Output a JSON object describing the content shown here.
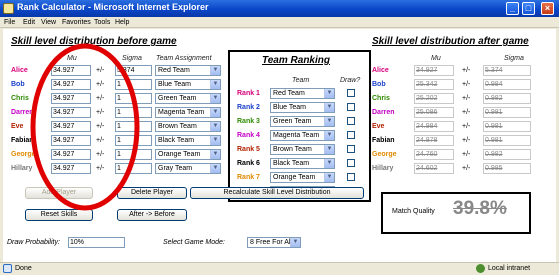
{
  "window": {
    "title": "Rank Calculator - Microsoft Internet Explorer",
    "min": "_",
    "max": "□",
    "close": "×"
  },
  "menu": [
    "File",
    "Edit",
    "View",
    "Favorites",
    "Tools",
    "Help"
  ],
  "before": {
    "heading": "Skill level distribution before game",
    "col_mu": "Mu",
    "col_sigma": "Sigma",
    "col_team": "Team Assignment",
    "pm": "+/-",
    "players": [
      {
        "name": "Alice",
        "color": "#d6007a",
        "mu": "34.927",
        "sigma": "5.374",
        "team": "Red Team"
      },
      {
        "name": "Bob",
        "color": "#1a3fc9",
        "mu": "34.927",
        "sigma": "1",
        "team": "Blue Team"
      },
      {
        "name": "Chris",
        "color": "#2e8b00",
        "mu": "34.927",
        "sigma": "1",
        "team": "Green Team"
      },
      {
        "name": "Darren",
        "color": "#c400c4",
        "mu": "34.927",
        "sigma": "1",
        "team": "Magenta Team"
      },
      {
        "name": "Eve",
        "color": "#b02000",
        "mu": "34.927",
        "sigma": "1",
        "team": "Brown Team"
      },
      {
        "name": "Fabian",
        "color": "#000000",
        "mu": "34.927",
        "sigma": "1",
        "team": "Black Team"
      },
      {
        "name": "George",
        "color": "#e08a00",
        "mu": "34.927",
        "sigma": "1",
        "team": "Orange Team"
      },
      {
        "name": "Hillary",
        "color": "#777777",
        "mu": "34.927",
        "sigma": "1",
        "team": "Gray Team"
      }
    ]
  },
  "ranking": {
    "heading": "Team Ranking",
    "col_team": "Team",
    "col_draw": "Draw?",
    "ranks": [
      {
        "label": "Rank 1",
        "color": "#d6007a",
        "team": "Red Team"
      },
      {
        "label": "Rank 2",
        "color": "#1a3fc9",
        "team": "Blue Team"
      },
      {
        "label": "Rank 3",
        "color": "#2e8b00",
        "team": "Green Team"
      },
      {
        "label": "Rank 4",
        "color": "#c400c4",
        "team": "Magenta Team"
      },
      {
        "label": "Rank 5",
        "color": "#b02000",
        "team": "Brown Team"
      },
      {
        "label": "Rank 6",
        "color": "#000000",
        "team": "Black Team"
      },
      {
        "label": "Rank 7",
        "color": "#e08a00",
        "team": "Orange Team"
      },
      {
        "label": "Rank 8",
        "color": "#777777",
        "team": "Gray Team"
      }
    ]
  },
  "after": {
    "heading": "Skill level distribution after game",
    "col_mu": "Mu",
    "col_sigma": "Sigma",
    "pm": "+/-",
    "players": [
      {
        "name": "Alice",
        "color": "#d6007a",
        "mu": "34.927",
        "sigma": "5.374"
      },
      {
        "name": "Bob",
        "color": "#1a3fc9",
        "mu": "25.342",
        "sigma": "0.984"
      },
      {
        "name": "Chris",
        "color": "#2e8b00",
        "mu": "25.202",
        "sigma": "0.982"
      },
      {
        "name": "Darren",
        "color": "#c400c4",
        "mu": "25.086",
        "sigma": "0.981"
      },
      {
        "name": "Eve",
        "color": "#b02000",
        "mu": "24.984",
        "sigma": "0.981"
      },
      {
        "name": "Fabian",
        "color": "#000000",
        "mu": "24.878",
        "sigma": "0.981"
      },
      {
        "name": "George",
        "color": "#e08a00",
        "mu": "24.760",
        "sigma": "0.982"
      },
      {
        "name": "Hillary",
        "color": "#777777",
        "mu": "24.602",
        "sigma": "0.985"
      }
    ]
  },
  "buttons": {
    "add_player": "Add Player",
    "delete_player": "Delete Player",
    "recalc": "Recalculate Skill Level Distribution",
    "reset_skills": "Reset Skills",
    "after_before": "After -> Before"
  },
  "match_quality": {
    "label": "Match Quality",
    "value": "39.8%"
  },
  "footer": {
    "draw_prob_label": "Draw Probability:",
    "draw_prob_value": "10%",
    "game_mode_label": "Select Game Mode:",
    "game_mode_value": "8 Free For All"
  },
  "status": {
    "left": "Done",
    "right": "Local intranet"
  },
  "annotation": {
    "circle_color": "#e00000"
  }
}
